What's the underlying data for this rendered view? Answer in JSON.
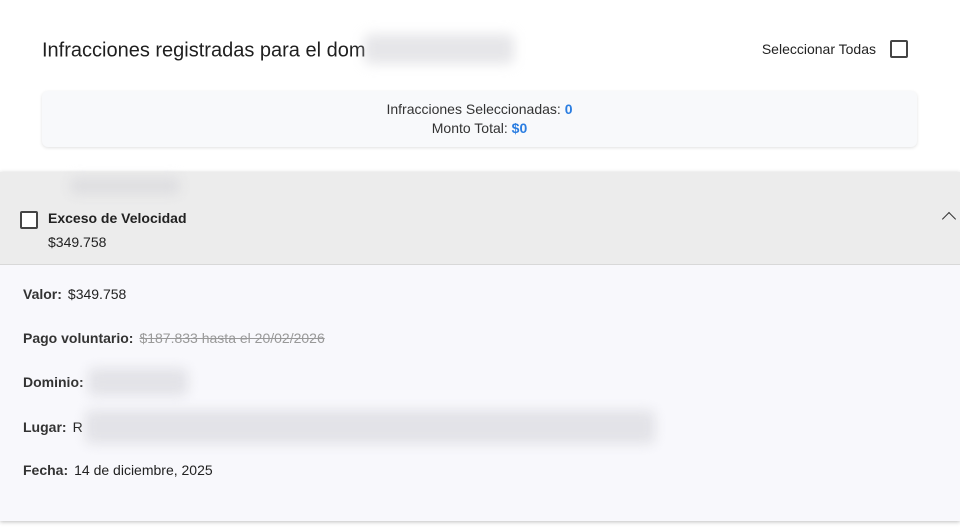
{
  "header": {
    "title": "Infracciones registradas para el dom",
    "select_all_label": "Seleccionar Todas"
  },
  "summary": {
    "selected_label": "Infracciones Seleccionadas:",
    "selected_count": "0",
    "total_label": "Monto Total:",
    "total_amount": "$0"
  },
  "infraction": {
    "name": "Exceso de Velocidad",
    "amount": "$349.758",
    "details": {
      "valor_label": "Valor:",
      "valor_value": "$349.758",
      "pago_label": "Pago voluntario:",
      "pago_value": "$187.833 hasta el 20/02/2026",
      "dominio_label": "Dominio:",
      "lugar_label": "Lugar:",
      "lugar_value_start": "R",
      "fecha_label": "Fecha:",
      "fecha_value": "14 de diciembre, 2025"
    }
  },
  "colors": {
    "accent": "#2a7de1",
    "panel_header": "#ececec",
    "panel_body": "#f8f8fc"
  },
  "icons": {
    "collapse": "chevron-up-icon"
  }
}
